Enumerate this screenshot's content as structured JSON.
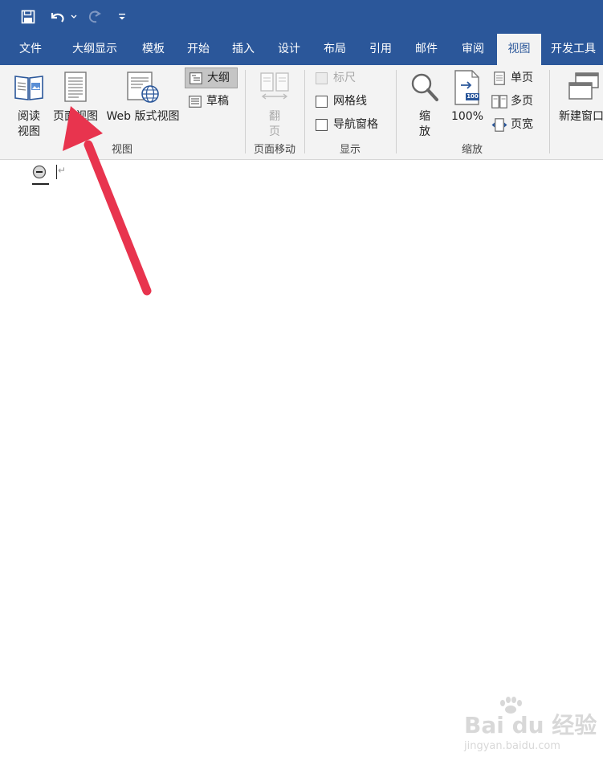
{
  "quick_access": {
    "icons": [
      "save-icon",
      "undo-icon",
      "redo-icon",
      "customize-qat-icon"
    ]
  },
  "tabs": [
    {
      "label": "文件"
    },
    {
      "label": "大纲显示"
    },
    {
      "label": "模板"
    },
    {
      "label": "开始"
    },
    {
      "label": "插入"
    },
    {
      "label": "设计"
    },
    {
      "label": "布局"
    },
    {
      "label": "引用"
    },
    {
      "label": "邮件"
    },
    {
      "label": "审阅"
    },
    {
      "label": "视图",
      "active": true
    },
    {
      "label": "开发工具"
    }
  ],
  "ribbon": {
    "views": {
      "read_mode_line1": "阅读",
      "read_mode_line2": "视图",
      "print_layout": "页面视图",
      "web_layout": "Web 版式视图",
      "outline": "大纲",
      "draft": "草稿",
      "group_label": "视图"
    },
    "page_movement": {
      "flip_line1": "翻",
      "flip_line2": "页",
      "group_label": "页面移动"
    },
    "show": {
      "ruler": "标尺",
      "gridlines": "网格线",
      "nav_pane": "导航窗格",
      "group_label": "显示"
    },
    "zoom": {
      "zoom_line1": "缩",
      "zoom_line2": "放",
      "hundred": "100%",
      "hundred_badge": "100",
      "one_page": "单页",
      "multiple_pages": "多页",
      "page_width": "页宽",
      "group_label": "缩放"
    },
    "window": {
      "new_window": "新建窗口"
    }
  },
  "document": {
    "paragraph_mark": "↵"
  },
  "watermark": {
    "brand": "Bai du 经验",
    "url": "jingyan.baidu.com"
  },
  "colors": {
    "title_bar": "#2b579a",
    "ribbon_bg": "#f3f3f3",
    "arrow": "#e8344e"
  }
}
